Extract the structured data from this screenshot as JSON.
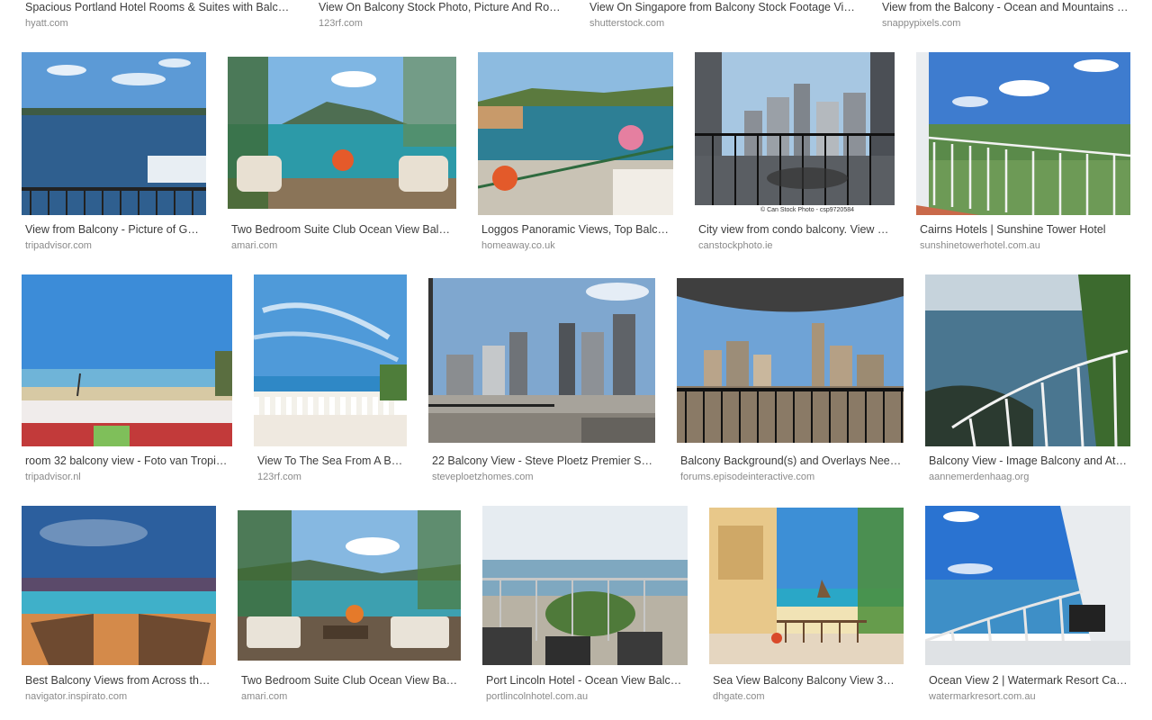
{
  "results": {
    "row0": [
      {
        "title": "Spacious Portland Hotel Rooms & Suites with Balc…",
        "source": "hyatt.com"
      },
      {
        "title": "View On Balcony Stock Photo, Picture And Ro…",
        "source": "123rf.com"
      },
      {
        "title": "View On Singapore from Balcony Stock Footage Vi…",
        "source": "shutterstock.com"
      },
      {
        "title": "View from the Balcony - Ocean and Mountains …",
        "source": "snappypixels.com"
      }
    ],
    "row1": [
      {
        "title": "View from Balcony - Picture of G…",
        "source": "tripadvisor.com"
      },
      {
        "title": "Two Bedroom Suite Club Ocean View Bal…",
        "source": "amari.com"
      },
      {
        "title": "Loggos Panoramic Views, Top Balc…",
        "source": "homeaway.co.uk"
      },
      {
        "title": "City view from condo balcony. View …",
        "source": "canstockphoto.ie",
        "watermark": "© Can Stock Photo - csp9720584"
      },
      {
        "title": "Cairns Hotels | Sunshine Tower Hotel",
        "source": "sunshinetowerhotel.com.au"
      }
    ],
    "row2": [
      {
        "title": "room 32 balcony view - Foto van Tropi…",
        "source": "tripadvisor.nl"
      },
      {
        "title": "View To The Sea From A B…",
        "source": "123rf.com"
      },
      {
        "title": "22 Balcony View - Steve Ploetz Premier S…",
        "source": "steveploetzhomes.com"
      },
      {
        "title": "Balcony Background(s) and Overlays Nee…",
        "source": "forums.episodeinteractive.com"
      },
      {
        "title": "Balcony View - Image Balcony and At…",
        "source": "aannemerdenhaag.org"
      }
    ],
    "row3": [
      {
        "title": "Best Balcony Views from Across th…",
        "source": "navigator.inspirato.com"
      },
      {
        "title": "Two Bedroom Suite Club Ocean View Ba…",
        "source": "amari.com"
      },
      {
        "title": "Port Lincoln Hotel - Ocean View Balc…",
        "source": "portlincolnhotel.com.au"
      },
      {
        "title": "Sea View Balcony Balcony View 3…",
        "source": "dhgate.com"
      },
      {
        "title": "Ocean View 2 | Watermark Resort Ca…",
        "source": "watermarkresort.com.au"
      }
    ]
  }
}
